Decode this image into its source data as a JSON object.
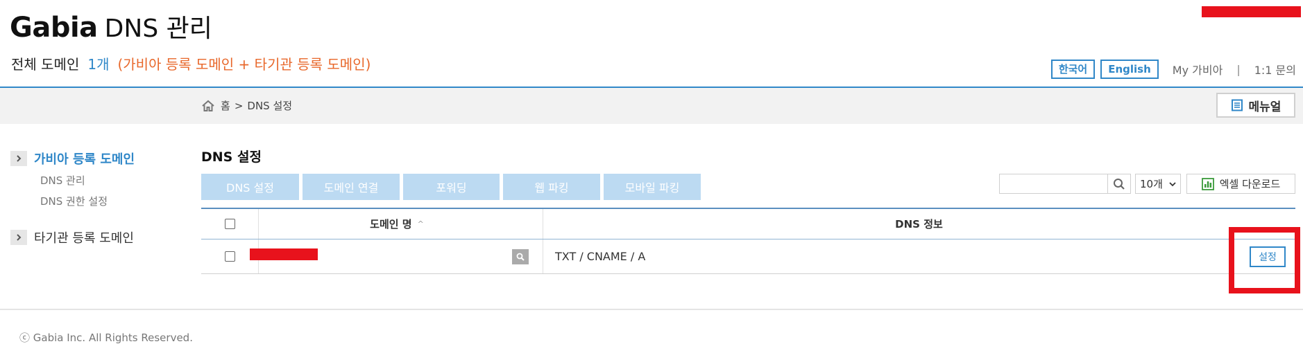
{
  "header": {
    "brand": "Gabia",
    "title_rest": "DNS 관리",
    "summary_label": "전체 도메인",
    "summary_count": "1개",
    "summary_note": "(가비아 등록 도메인 + 타기관 등록 도메인)",
    "lang_korean": "한국어",
    "lang_english": "English",
    "my_gabia": "My 가비아",
    "separator": "|",
    "inquiry": "1:1 문의"
  },
  "breadcrumb": {
    "home": "홈",
    "arrow": ">",
    "current": "DNS 설정"
  },
  "manual_button": "메뉴얼",
  "sidebar": {
    "items": [
      {
        "label": "가비아 등록 도메인",
        "active": true,
        "subitems": [
          "DNS 관리",
          "DNS 권한 설정"
        ]
      },
      {
        "label": "타기관 등록 도메인",
        "active": false,
        "subitems": []
      }
    ]
  },
  "main": {
    "title": "DNS 설정",
    "tabs": [
      {
        "label": "DNS 설정"
      },
      {
        "label": "도메인 연결"
      },
      {
        "label": "포워딩"
      },
      {
        "label": "웹 파킹"
      },
      {
        "label": "모바일 파킹"
      }
    ],
    "search": {
      "placeholder": ""
    },
    "page_size": "10개",
    "excel_download": "엑셀 다운로드"
  },
  "table": {
    "columns": [
      "도메인 명",
      "DNS 정보"
    ],
    "sort_indicator": "^",
    "rows": [
      {
        "domain": "",
        "dns_info": "TXT / CNAME / A",
        "action": "설정"
      }
    ]
  },
  "footer": {
    "copyright": "ⓒ Gabia Inc. All Rights Reserved."
  },
  "colors": {
    "accent": "#2f87c8",
    "note": "#e8672a",
    "tab_bg": "#bcdaf2",
    "redaction": "#e8121c"
  }
}
